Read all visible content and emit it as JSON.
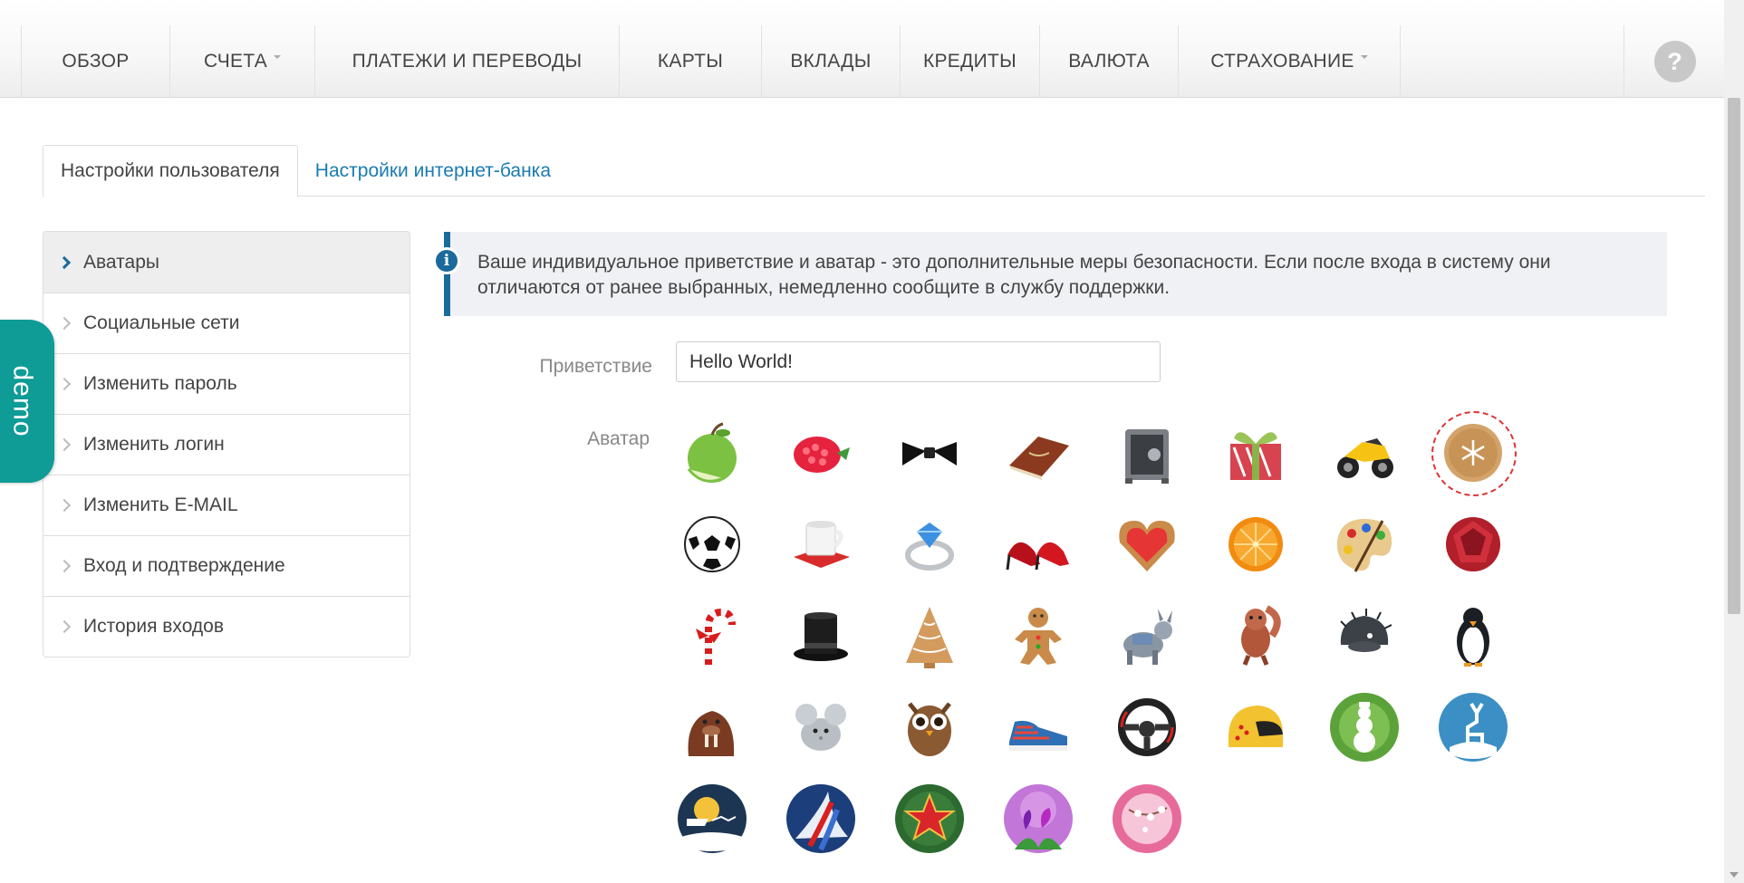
{
  "nav": {
    "items": [
      {
        "label": "ОБЗОР",
        "dropdown": false
      },
      {
        "label": "СЧЕТА",
        "dropdown": true
      },
      {
        "label": "ПЛАТЕЖИ И ПЕРЕВОДЫ",
        "dropdown": false
      },
      {
        "label": "КАРТЫ",
        "dropdown": false
      },
      {
        "label": "ВКЛАДЫ",
        "dropdown": false
      },
      {
        "label": "КРЕДИТЫ",
        "dropdown": false
      },
      {
        "label": "ВАЛЮТА",
        "dropdown": false
      },
      {
        "label": "СТРАХОВАНИЕ",
        "dropdown": true
      }
    ],
    "help_label": "?"
  },
  "tabs": [
    {
      "label": "Настройки пользователя",
      "active": true
    },
    {
      "label": "Настройки интернет-банка",
      "active": false
    }
  ],
  "sidebar": {
    "items": [
      {
        "label": "Аватары",
        "active": true
      },
      {
        "label": "Социальные сети",
        "active": false
      },
      {
        "label": "Изменить пароль",
        "active": false
      },
      {
        "label": "Изменить логин",
        "active": false
      },
      {
        "label": "Изменить E-MAIL",
        "active": false
      },
      {
        "label": "Вход и подтверждение",
        "active": false
      },
      {
        "label": "История входов",
        "active": false
      }
    ]
  },
  "demo_badge": "demo",
  "info": {
    "icon": "info-icon",
    "text": "Ваше индивидуальное приветствие и аватар - это дополнительные меры безопасности. Если после входа в систему они отличаются от ранее выбранных, немедленно сообщите в службу поддержки."
  },
  "form": {
    "greeting_label": "Приветствие",
    "greeting_value": "Hello World!",
    "avatar_label": "Аватар"
  },
  "avatars": [
    {
      "name": "apple"
    },
    {
      "name": "raspberry"
    },
    {
      "name": "bow-tie"
    },
    {
      "name": "book"
    },
    {
      "name": "safe"
    },
    {
      "name": "gift"
    },
    {
      "name": "motorcycle"
    },
    {
      "name": "cookie-snowflake",
      "selected": true
    },
    {
      "name": "soccer-ball"
    },
    {
      "name": "cup"
    },
    {
      "name": "ring"
    },
    {
      "name": "high-heels"
    },
    {
      "name": "heart-cookie"
    },
    {
      "name": "orange"
    },
    {
      "name": "palette"
    },
    {
      "name": "ruby"
    },
    {
      "name": "candy-cane"
    },
    {
      "name": "top-hat"
    },
    {
      "name": "tree-cookie"
    },
    {
      "name": "gingerbread-man"
    },
    {
      "name": "donkey"
    },
    {
      "name": "squirrel"
    },
    {
      "name": "hedgehog"
    },
    {
      "name": "penguin"
    },
    {
      "name": "walrus"
    },
    {
      "name": "chinchilla"
    },
    {
      "name": "owl"
    },
    {
      "name": "sneaker"
    },
    {
      "name": "steering-wheel"
    },
    {
      "name": "helmet"
    },
    {
      "name": "snowman-badge"
    },
    {
      "name": "deer-badge"
    },
    {
      "name": "santa-sleigh-badge"
    },
    {
      "name": "jets-badge"
    },
    {
      "name": "star-badge"
    },
    {
      "name": "tulips-badge"
    },
    {
      "name": "blossom-badge"
    }
  ],
  "colors": {
    "accent": "#1a6a9c",
    "link": "#1a7bb0",
    "demo": "#0f9b96",
    "selected_ring": "#dd3333"
  }
}
